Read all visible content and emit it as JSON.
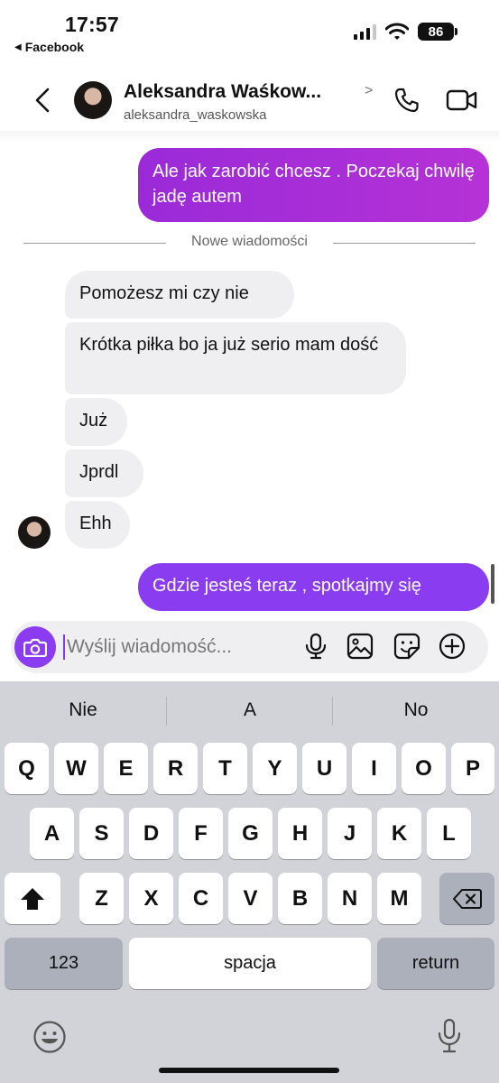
{
  "status_bar": {
    "time": "17:57",
    "back_app": "Facebook",
    "battery": "86"
  },
  "header": {
    "name": "Aleksandra Waśkow...",
    "username": "aleksandra_waskowska"
  },
  "messages": [
    {
      "direction": "out",
      "text": "Ale jak zarobić chcesz . Poczekaj chwilę jadę autem"
    },
    {
      "direction": "in",
      "text": "Pomożesz mi czy nie"
    },
    {
      "direction": "in",
      "text": "Krótka piłka bo ja już serio mam dość"
    },
    {
      "direction": "in",
      "text": "Już"
    },
    {
      "direction": "in",
      "text": "Jprdl"
    },
    {
      "direction": "in",
      "text": "Ehh"
    },
    {
      "direction": "out",
      "text": "Gdzie jesteś teraz , spotkajmy się"
    }
  ],
  "divider_text": "Nowe wiadomości",
  "composer": {
    "placeholder": "Wyślij wiadomość...",
    "icons": [
      "camera-icon",
      "microphone-icon",
      "gallery-icon",
      "sticker-icon",
      "plus-circle-icon"
    ]
  },
  "keyboard": {
    "suggestions": [
      "Nie",
      "A",
      "No"
    ],
    "row1": [
      "Q",
      "W",
      "E",
      "R",
      "T",
      "Y",
      "U",
      "I",
      "O",
      "P"
    ],
    "row2": [
      "A",
      "S",
      "D",
      "F",
      "G",
      "H",
      "J",
      "K",
      "L"
    ],
    "row3": [
      "Z",
      "X",
      "C",
      "V",
      "B",
      "N",
      "M"
    ],
    "numbers_key": "123",
    "space_key": "spacja",
    "return_key": "return",
    "icons": [
      "shift-icon",
      "backspace-icon",
      "emoji-icon",
      "dictation-icon"
    ]
  }
}
